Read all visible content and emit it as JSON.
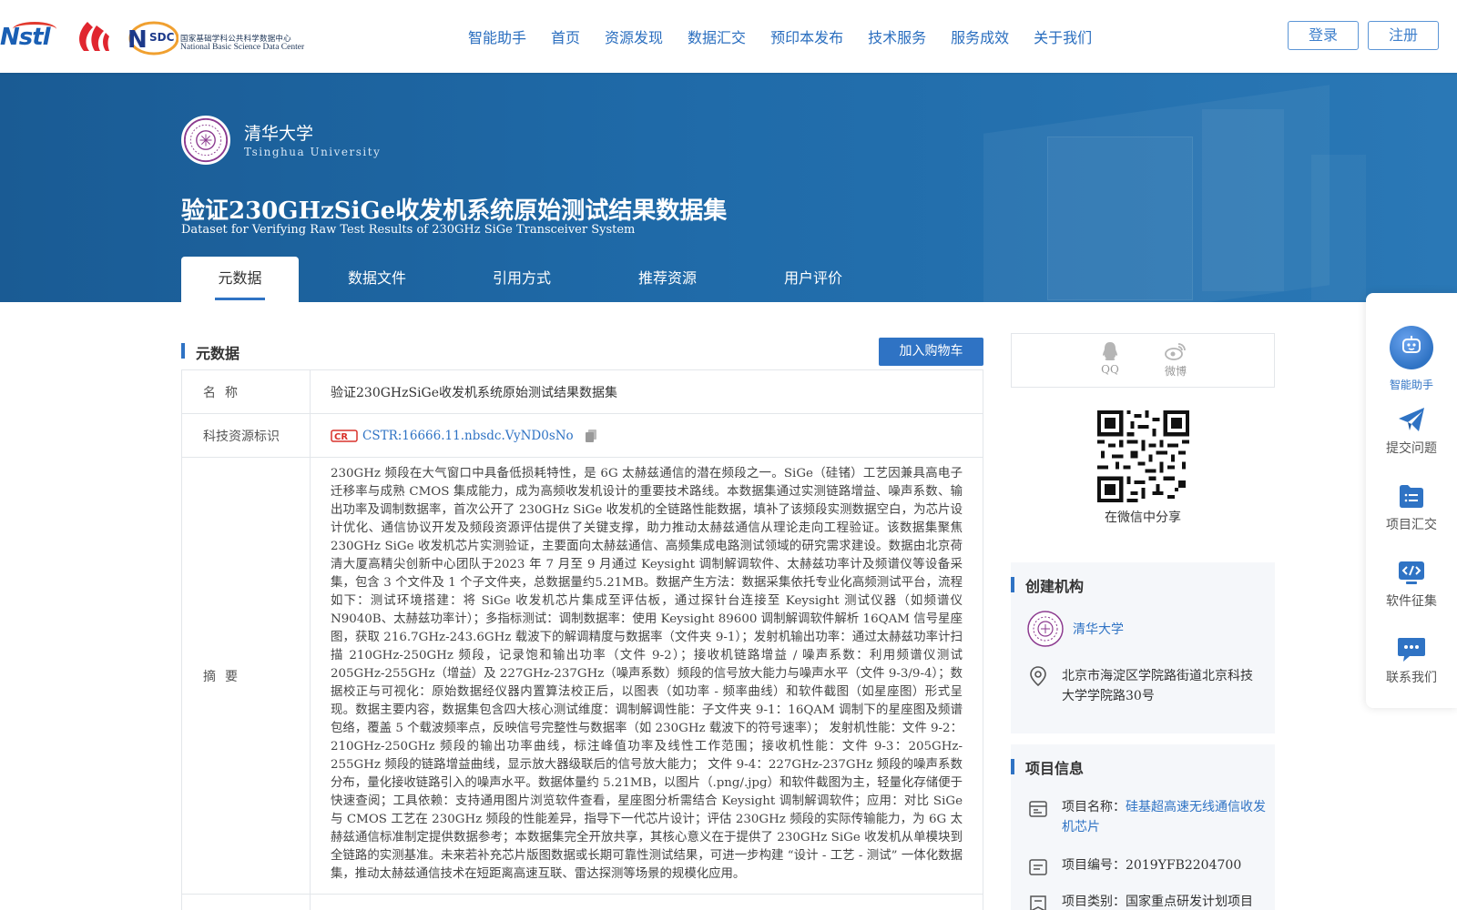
{
  "header": {
    "logo_nstl": "Nstl",
    "logo_nsdc_cn": "国家基础学科公共科学数据中心",
    "logo_nsdc_en": "National Basic Science Data Center",
    "logo_nsdc_mark": "SDC",
    "nav": [
      "智能助手",
      "首页",
      "资源发现",
      "数据汇交",
      "预印本发布",
      "技术服务",
      "服务成效",
      "关于我们"
    ],
    "login": "登录",
    "register": "注册"
  },
  "banner": {
    "university_cn": "清华大学",
    "university_en": "Tsinghua University",
    "title_cn": "验证230GHzSiGe收发机系统原始测试结果数据集",
    "title_en": "Dataset for Verifying Raw Test Results of 230GHz SiGe Transceiver System",
    "tabs": [
      "元数据",
      "数据文件",
      "引用方式",
      "推荐资源",
      "用户评价"
    ],
    "active_tab": "元数据"
  },
  "metadata": {
    "section_title": "元数据",
    "cart_button": "加入购物车",
    "rows": {
      "name_label": "名称",
      "name_value": "验证230GHzSiGe收发机系统原始测试结果数据集",
      "cstr_label": "科技资源标识",
      "cstr_value": "CSTR:16666.11.nbsdc.VyND0sNo",
      "abstract_label": "摘要",
      "abstract_value": "230GHz 频段在大气窗口中具备低损耗特性，是 6G 太赫兹通信的潜在频段之一。SiGe（硅锗）工艺因兼具高电子迁移率与成熟 CMOS 集成能力，成为高频收发机设计的重要技术路线。本数据集通过实测链路增益、噪声系数、输出功率及调制数据率，首次公开了 230GHz SiGe 收发机的全链路性能数据，填补了该频段实测数据空白，为芯片设计优化、通信协议开发及频段资源评估提供了关键支撑，助力推动太赫兹通信从理论走向工程验证。该数据集聚焦230GHz SiGe 收发机芯片实测验证，主要面向太赫兹通信、高频集成电路测试领域的研究需求建设。数据由北京荷清大厦高精尖创新中心团队于2023 年 7 月至 9 月通过 Keysight 调制解调软件、太赫兹功率计及频谱仪等设备采集，包含 3 个文件及 1 个子文件夹，总数据量约5.21MB。数据产生方法：数据采集依托专业化高频测试平台，流程如下：测试环境搭建：将 SiGe 收发机芯片集成至评估板，通过探针台连接至 Keysight 测试仪器（如频谱仪 N9040B、太赫兹功率计）；多指标测试：调制数据率：使用 Keysight 89600 调制解调软件解析 16QAM 信号星座图，获取 216.7GHz-243.6GHz 载波下的解调精度与数据率（文件夹 9-1）；发射机输出功率：通过太赫兹功率计扫描 210GHz-250GHz 频段，记录饱和输出功率（文件 9-2）；接收机链路增益 / 噪声系数：利用频谱仪测试205GHz-255GHz（增益）及 227GHz-237GHz（噪声系数）频段的信号放大能力与噪声水平（文件 9-3/9-4）；数据校正与可视化：原始数据经仪器内置算法校正后，以图表（如功率 - 频率曲线）和软件截图（如星座图）形式呈现。数据主要内容，数据集包含四大核心测试维度：调制解调性能：子文件夹 9-1：16QAM 调制下的星座图及频谱包络，覆盖 5 个载波频率点，反映信号完整性与数据率（如 230GHz 载波下的符号速率）； 发射机性能：文件 9-2：210GHz-250GHz 频段的输出功率曲线，标注峰值功率及线性工作范围；接收机性能：文件 9-3：205GHz-255GHz 频段的链路增益曲线，显示放大器级联后的信号放大能力； 文件 9-4：227GHz-237GHz 频段的噪声系数分布，量化接收链路引入的噪声水平。数据体量约 5.21MB，以图片（.png/.jpg）和软件截图为主，轻量化存储便于快速查阅；工具依赖：支持通用图片浏览软件查看，星座图分析需结合 Keysight 调制解调软件；应用：对比 SiGe 与 CMOS 工艺在 230GHz 频段的性能差异，指导下一代芯片设计；评估 230GHz 频段的实际传输能力，为 6G 太赫兹通信标准制定提供数据参考；本数据集完全开放共享，其核心意义在于提供了 230GHz SiGe 收发机从单模块到全链路的实测基准。未来若补充芯片版图数据或长期可靠性测试结果，可进一步构建 “设计 - 工艺 - 测试” 一体化数据集，推动太赫兹通信技术在短距离高速互联、雷达探测等场景的规模化应用。"
    }
  },
  "sidebar": {
    "share": [
      {
        "label": "QQ",
        "icon": "qq-icon"
      },
      {
        "label": "微博",
        "icon": "weibo-icon"
      }
    ],
    "qr_caption": "在微信中分享",
    "org_section_title": "创建机构",
    "org_name": "清华大学",
    "org_address": "北京市海淀区学院路街道北京科技大学学院路30号",
    "project_section_title": "项目信息",
    "project_name_label": "项目名称：",
    "project_name_value": "硅基超高速无线通信收发机芯片",
    "project_number": "项目编号：2019YFB2204700",
    "project_category": "项目类别：国家重点研发计划项目"
  },
  "float_toolbar": {
    "items": [
      "智能助手",
      "提交问题",
      "项目汇交",
      "软件征集",
      "联系我们"
    ]
  },
  "colors": {
    "primary": "#2f73c4",
    "banner": "#1f6aa8",
    "nav_text": "#2a6ebf",
    "panel_bg": "#f5f7fa"
  }
}
